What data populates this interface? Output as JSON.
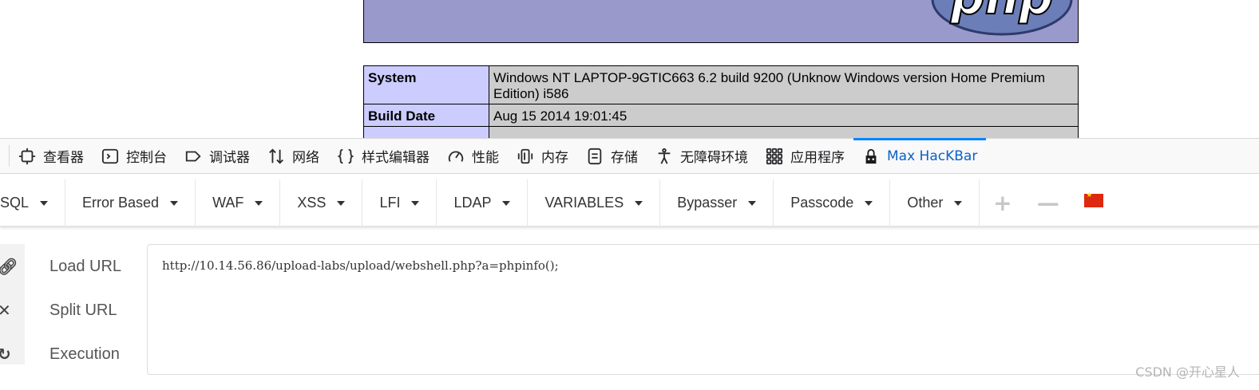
{
  "phpinfo": {
    "logo_text": "php",
    "rows": [
      {
        "label": "System",
        "value": "Windows NT LAPTOP-9GTIC663 6.2 build 9200 (Unknow Windows version Home Premium Edition) i586"
      },
      {
        "label": "Build Date",
        "value": "Aug 15 2014 19:01:45"
      }
    ]
  },
  "devtools": {
    "tabs": [
      {
        "label": "查看器",
        "icon": "inspector-icon"
      },
      {
        "label": "控制台",
        "icon": "console-icon"
      },
      {
        "label": "调试器",
        "icon": "debugger-icon"
      },
      {
        "label": "网络",
        "icon": "network-icon"
      },
      {
        "label": "样式编辑器",
        "icon": "style-editor-icon"
      },
      {
        "label": "性能",
        "icon": "performance-icon"
      },
      {
        "label": "内存",
        "icon": "memory-icon"
      },
      {
        "label": "存储",
        "icon": "storage-icon"
      },
      {
        "label": "无障碍环境",
        "icon": "accessibility-icon"
      },
      {
        "label": "应用程序",
        "icon": "application-icon"
      },
      {
        "label": "Max HacKBar",
        "icon": "hackbar-lock-icon",
        "active": true
      }
    ],
    "accent_color": "#0a84ff"
  },
  "hackbar": {
    "menus": [
      "SQL",
      "Error Based",
      "WAF",
      "XSS",
      "LFI",
      "LDAP",
      "VARIABLES",
      "Bypasser",
      "Passcode",
      "Other"
    ],
    "add_icon": "+",
    "remove_icon": "—",
    "flag_icon": "china-flag-icon",
    "actions": [
      {
        "label": "Load URL",
        "icon": "link-icon"
      },
      {
        "label": "Split URL",
        "icon": "scissors-icon"
      },
      {
        "label": "Execution",
        "icon": "refresh-icon"
      }
    ],
    "url_value": "http://10.14.56.86/upload-labs/upload/webshell.php?a=phpinfo();"
  },
  "watermark": "CSDN @开心星人"
}
